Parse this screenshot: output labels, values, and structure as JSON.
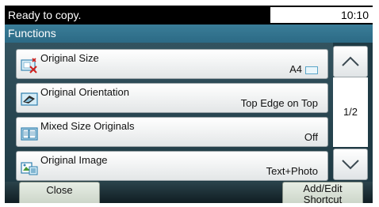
{
  "status": {
    "message": "Ready to copy.",
    "time": "10:10"
  },
  "header": {
    "title": "Functions"
  },
  "functions": [
    {
      "label": "Original Size",
      "value": "A4",
      "icon": "original-size-icon"
    },
    {
      "label": "Original Orientation",
      "value": "Top Edge on Top",
      "icon": "orientation-icon"
    },
    {
      "label": "Mixed Size Originals",
      "value": "Off",
      "icon": "mixed-size-icon"
    },
    {
      "label": "Original Image",
      "value": "Text+Photo",
      "icon": "original-image-icon"
    }
  ],
  "pager": {
    "page": "1/2",
    "up_icon": "chevron-up-icon",
    "down_icon": "chevron-down-icon"
  },
  "footer": {
    "close_label": "Close",
    "shortcut_label_line1": "Add/Edit",
    "shortcut_label_line2": "Shortcut"
  },
  "colors": {
    "header": "#2c6a85",
    "list_bg": "#1f3a44",
    "button_face": "#e3e6e7"
  }
}
